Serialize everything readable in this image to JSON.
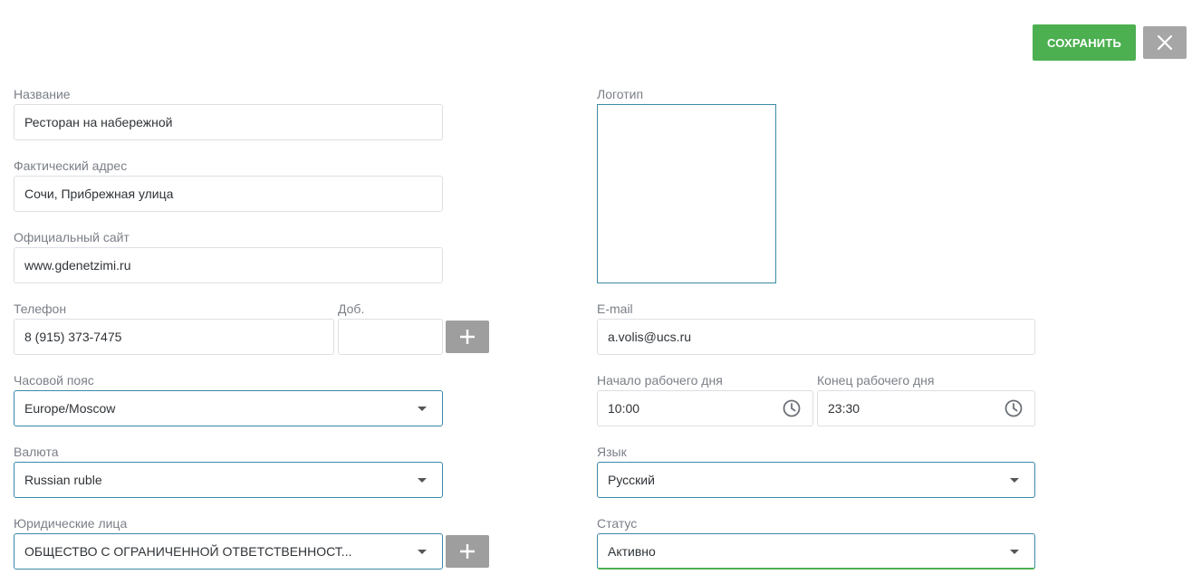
{
  "header": {
    "save_label": "СОХРАНИТЬ",
    "close_icon": "close-icon"
  },
  "form": {
    "name": {
      "label": "Название",
      "value": "Ресторан на набережной"
    },
    "address": {
      "label": "Фактический адрес",
      "value": "Сочи, Прибрежная улица"
    },
    "website": {
      "label": "Официальный сайт",
      "value": "www.gdenetzimi.ru"
    },
    "phone": {
      "label": "Телефон",
      "value": "8 (915) 373-7475"
    },
    "extension": {
      "label": "Доб.",
      "value": ""
    },
    "timezone": {
      "label": "Часовой пояс",
      "value": "Europe/Moscow"
    },
    "currency": {
      "label": "Валюта",
      "value": "Russian ruble"
    },
    "legal_entities": {
      "label": "Юридические лица",
      "value": "ОБЩЕСТВО С ОГРАНИЧЕННОЙ ОТВЕТСТВЕННОСТ..."
    },
    "logo": {
      "label": "Логотип"
    },
    "email": {
      "label": "E-mail",
      "value": "a.volis@ucs.ru"
    },
    "workday_start": {
      "label": "Начало рабочего дня",
      "value": "10:00"
    },
    "workday_end": {
      "label": "Конец рабочего дня",
      "value": "23:30"
    },
    "language": {
      "label": "Язык",
      "value": "Русский"
    },
    "status": {
      "label": "Статус",
      "value": "Активно"
    }
  },
  "colors": {
    "accent_green": "#4caf50",
    "focus_border": "#3a8aa7",
    "button_gray": "#9e9e9e"
  }
}
